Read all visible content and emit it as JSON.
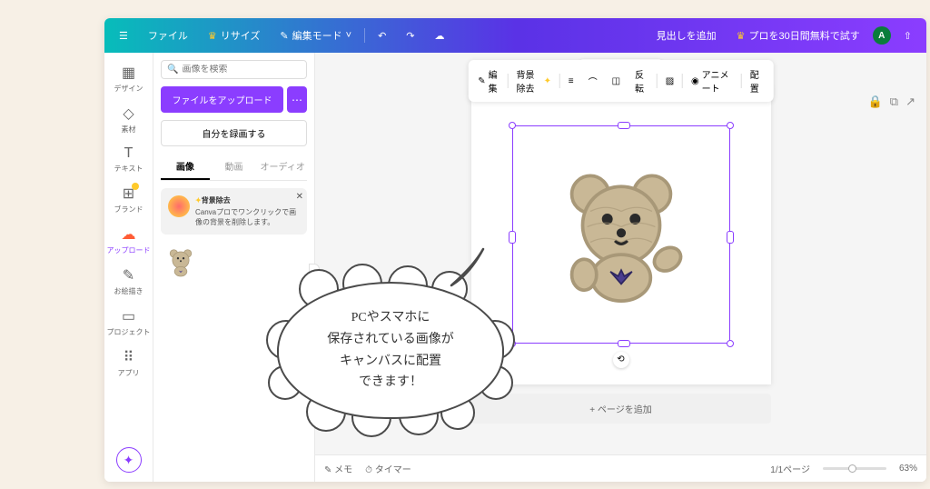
{
  "topbar": {
    "file": "ファイル",
    "resize": "リサイズ",
    "edit_mode": "編集モード",
    "add_heading": "見出しを追加",
    "try_pro": "プロを30日間無料で試す",
    "avatar_letter": "A"
  },
  "nav": {
    "design": "デザイン",
    "elements": "素材",
    "text": "テキスト",
    "brand": "ブランド",
    "upload": "アップロード",
    "drawing": "お絵描き",
    "projects": "プロジェクト",
    "apps": "アプリ"
  },
  "panel": {
    "search_placeholder": "画像を検索",
    "upload_file": "ファイルをアップロード",
    "record_self": "自分を録画する",
    "tab_image": "画像",
    "tab_video": "動画",
    "tab_audio": "オーディオ",
    "tip_title": "背景除去",
    "tip_body": "Canvaプロでワンクリックで画像の背景を削除します。"
  },
  "context": {
    "edit": "編集",
    "bg_remove": "背景除去",
    "flip": "反転",
    "animate": "アニメート",
    "position": "配置"
  },
  "canvas": {
    "add_page": "+ ページを追加"
  },
  "bottom": {
    "notes": "メモ",
    "timer": "タイマー",
    "page_indicator": "1/1ページ",
    "zoom": "63%"
  },
  "annotation": {
    "line1": "PCやスマホに",
    "line2": "保存されている画像が",
    "line3": "キャンバスに配置",
    "line4": "できます！"
  }
}
